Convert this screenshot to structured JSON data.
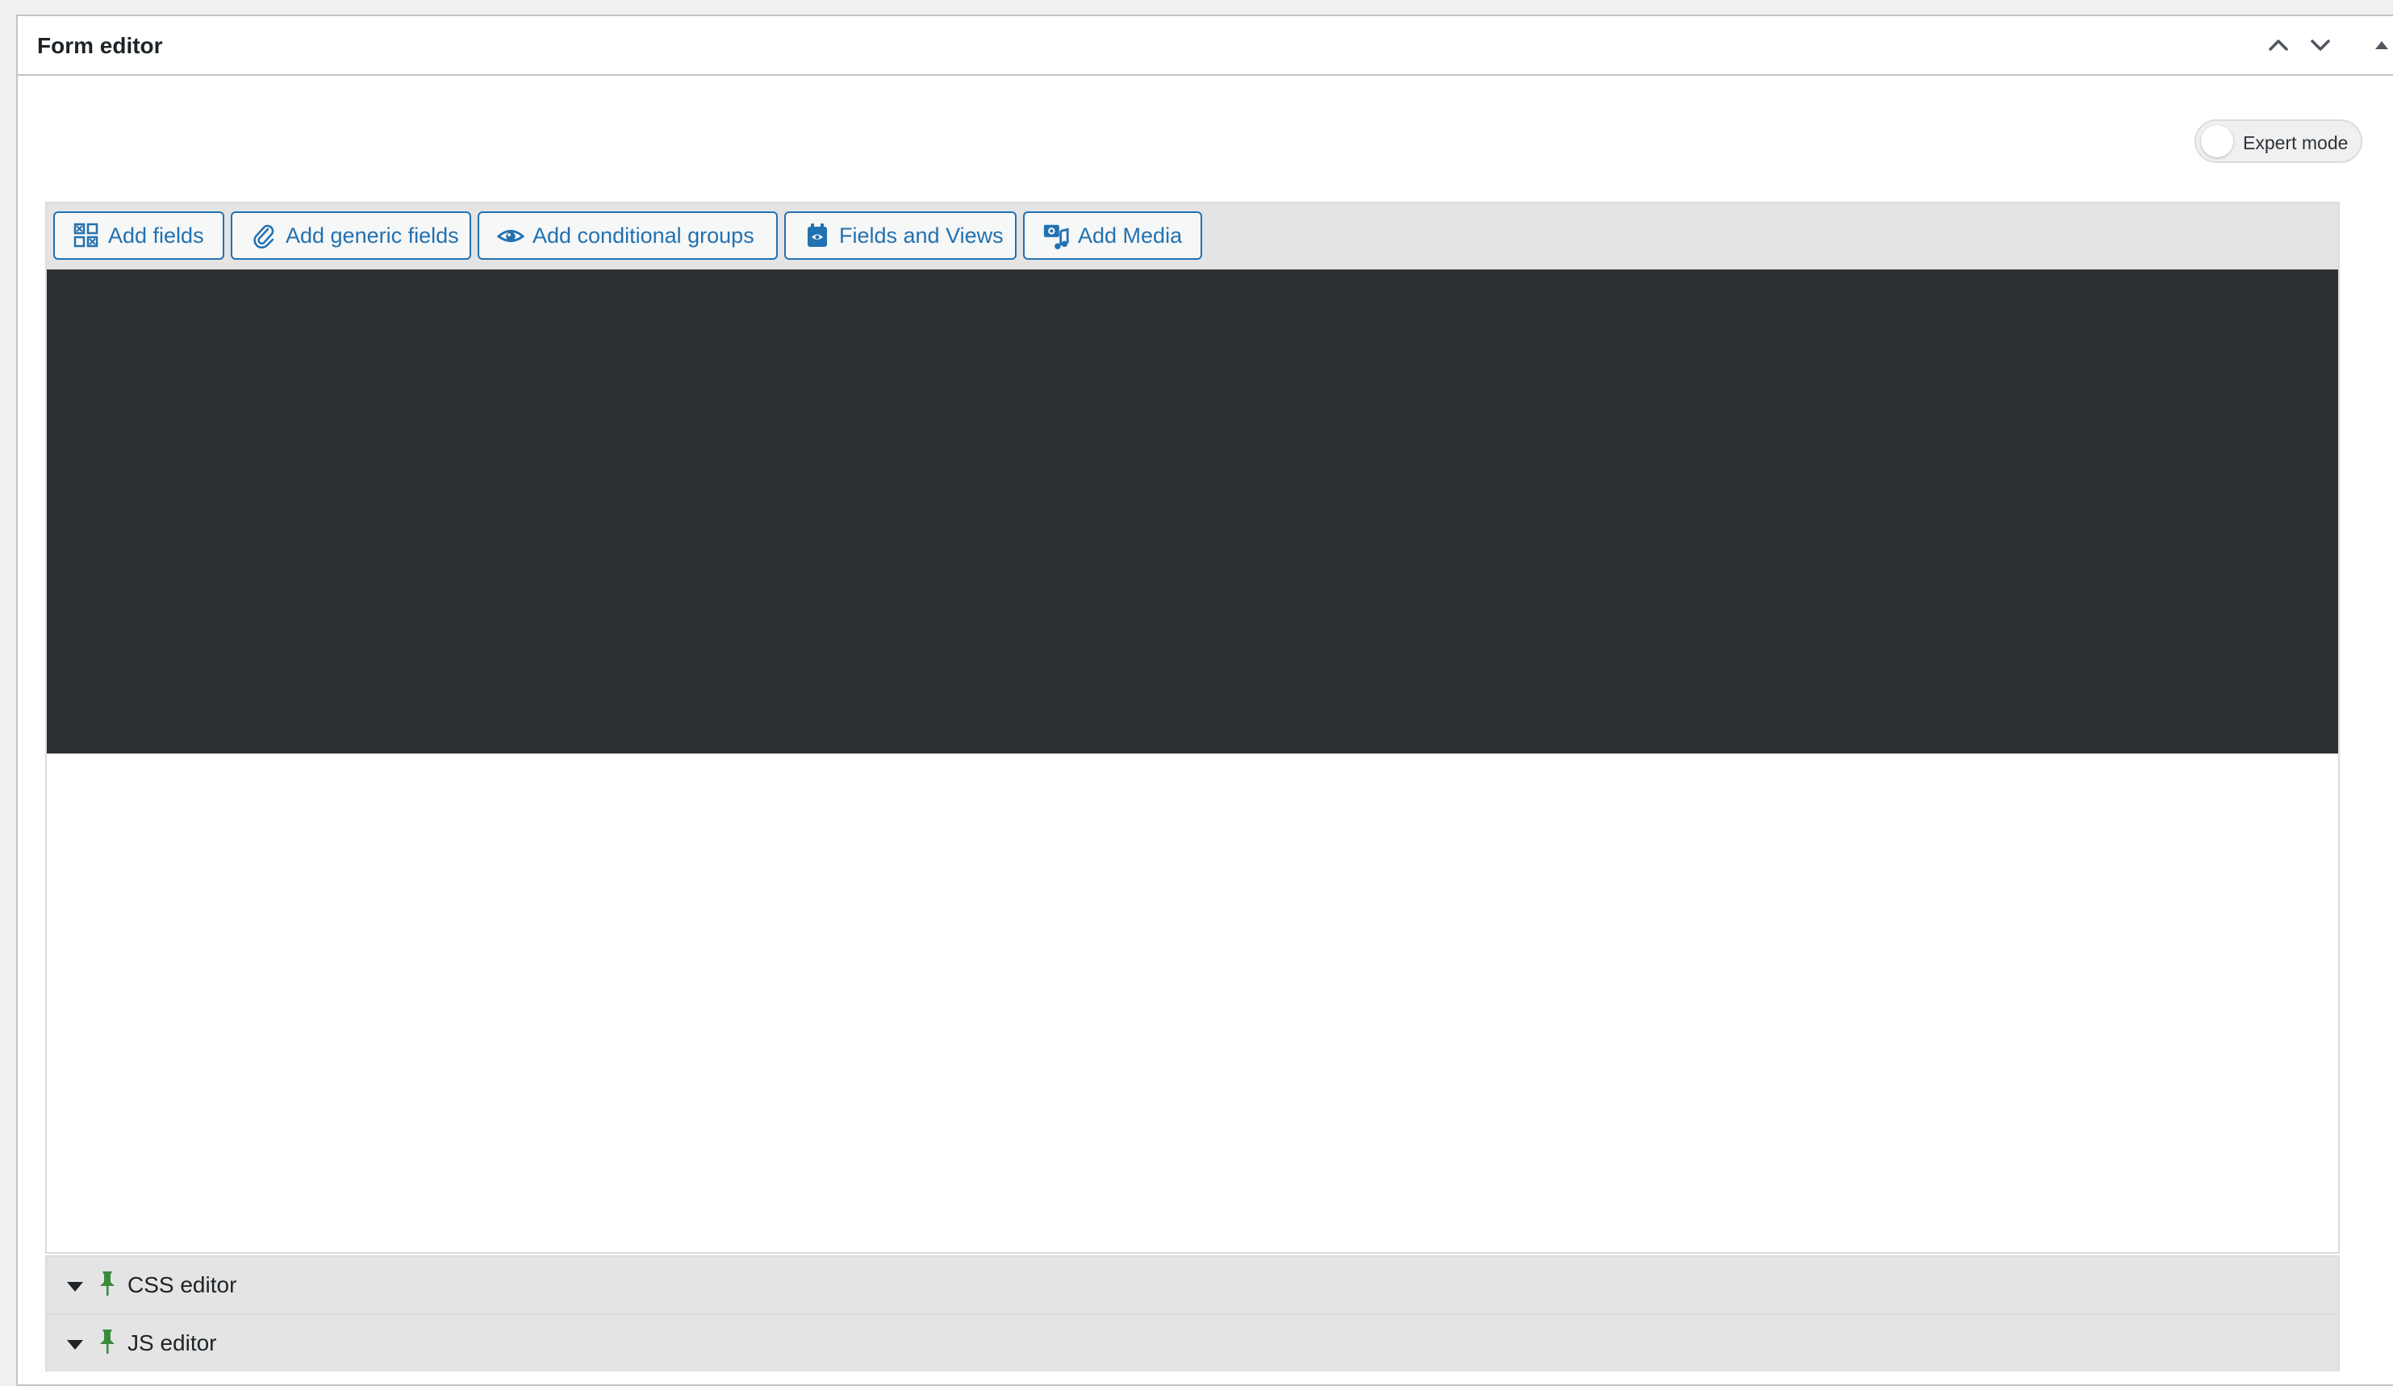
{
  "panel": {
    "title": "Form editor",
    "move_up_icon": "chevron-up-icon",
    "move_down_icon": "chevron-down-icon",
    "collapse_icon": "triangle-up-icon"
  },
  "expert_mode": {
    "label": "Expert mode",
    "enabled": false
  },
  "toolbar": {
    "buttons": [
      {
        "label": "Add fields",
        "icon": "fields-grid-icon"
      },
      {
        "label": "Add generic fields",
        "icon": "paperclip-icon"
      },
      {
        "label": "Add conditional groups",
        "icon": "eye-icon"
      },
      {
        "label": "Fields and Views",
        "icon": "calendar-icon"
      },
      {
        "label": "Add Media",
        "icon": "media-icon"
      }
    ]
  },
  "accordions": [
    {
      "label": "CSS editor",
      "icon": "pin-icon"
    },
    {
      "label": "JS editor",
      "icon": "pin-icon"
    }
  ],
  "colors": {
    "accent": "#2271b1",
    "editor_background": "#2c3035",
    "pin": "#3a8a3a"
  }
}
